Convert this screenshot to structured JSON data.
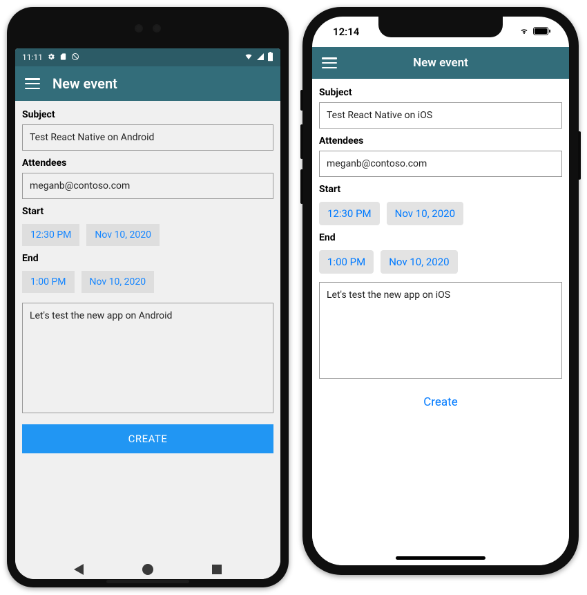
{
  "android": {
    "status": {
      "time": "11:11"
    },
    "title": "New event",
    "labels": {
      "subject": "Subject",
      "attendees": "Attendees",
      "start": "Start",
      "end": "End"
    },
    "subject": "Test React Native on Android",
    "attendees": "meganb@contoso.com",
    "start": {
      "time": "12:30 PM",
      "date": "Nov 10, 2020"
    },
    "end": {
      "time": "1:00 PM",
      "date": "Nov 10, 2020"
    },
    "notes": "Let's test the new app on Android",
    "create_label": "CREATE"
  },
  "ios": {
    "status": {
      "time": "12:14"
    },
    "title": "New event",
    "labels": {
      "subject": "Subject",
      "attendees": "Attendees",
      "start": "Start",
      "end": "End"
    },
    "subject": "Test React Native on iOS",
    "attendees": "meganb@contoso.com",
    "start": {
      "time": "12:30 PM",
      "date": "Nov 10, 2020"
    },
    "end": {
      "time": "1:00 PM",
      "date": "Nov 10, 2020"
    },
    "notes": "Let's test the new app on iOS",
    "create_label": "Create"
  },
  "colors": {
    "brand": "#336d7a",
    "accent_android": "#2196f3",
    "accent_ios": "#007aff"
  }
}
